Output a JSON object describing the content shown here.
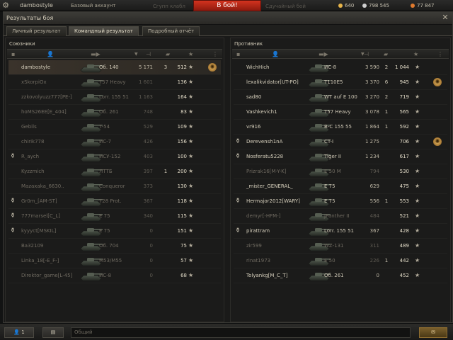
{
  "topbar": {
    "username": "dambostyle",
    "account": "Базовый аккаунт",
    "ghost_left": "Сгупп клабл",
    "ghost_right": "Сдучайный бой",
    "battle_button": "В бой!",
    "gold": "640",
    "credits": "798 545",
    "experience": "77 847",
    "colors": {
      "gold": "#e6b44a",
      "credits": "#cfcfcf",
      "experience": "#e07a2e"
    }
  },
  "window": {
    "title": "Результаты боя",
    "tabs": [
      "Личный результат",
      "Командный результат",
      "Подробный отчёт"
    ],
    "active_tab": 1
  },
  "allies": {
    "title": "Союзники",
    "players": [
      {
        "name": "dambostyle",
        "tank": "Об. 140",
        "damage": "5 171",
        "kills": "3",
        "xp": "512",
        "medal": false,
        "award": true,
        "dead": false,
        "me": true
      },
      {
        "name": "xSkorpiOx",
        "tank": "T57 Heavy",
        "damage": "1 601",
        "kills": "",
        "xp": "136",
        "medal": false,
        "award": false,
        "dead": true,
        "me": false
      },
      {
        "name": "zzkovolyuzz777[PE-]",
        "tank": "Lorr. 155 51",
        "damage": "1 163",
        "kills": "",
        "xp": "164",
        "medal": false,
        "award": false,
        "dead": true,
        "me": false
      },
      {
        "name": "hoMS26EE[E_404]",
        "tank": "Об. 261",
        "damage": "748",
        "kills": "",
        "xp": "83",
        "medal": false,
        "award": false,
        "dead": true,
        "me": false
      },
      {
        "name": "Gebils",
        "tank": "T-54",
        "damage": "529",
        "kills": "",
        "xp": "109",
        "medal": false,
        "award": false,
        "dead": true,
        "me": false
      },
      {
        "name": "chirik778",
        "tank": "ИС-7",
        "damage": "426",
        "kills": "",
        "xp": "156",
        "medal": false,
        "award": false,
        "dead": true,
        "me": false
      },
      {
        "name": "R_aych",
        "tank": "ИСУ-152",
        "damage": "403",
        "kills": "",
        "xp": "100",
        "medal": true,
        "award": false,
        "dead": true,
        "me": false
      },
      {
        "name": "Kyzzmich",
        "tank": "ЛТТБ",
        "damage": "397",
        "kills": "1",
        "xp": "200",
        "medal": false,
        "award": false,
        "dead": true,
        "me": false
      },
      {
        "name": "Mazaxaka_6630..",
        "tank": "Conqueror",
        "damage": "373",
        "kills": "",
        "xp": "130",
        "medal": false,
        "award": false,
        "dead": true,
        "me": false
      },
      {
        "name": "Gr0m_[AM-ST]",
        "tank": "T28 Prot.",
        "damage": "367",
        "kills": "",
        "xp": "118",
        "medal": true,
        "award": false,
        "dead": true,
        "me": false
      },
      {
        "name": "777marsel[C_L]",
        "tank": "E 75",
        "damage": "340",
        "kills": "",
        "xp": "115",
        "medal": true,
        "award": false,
        "dead": true,
        "me": false
      },
      {
        "name": "kyyyct[MSKIL]",
        "tank": "E 75",
        "damage": "0",
        "kills": "",
        "xp": "151",
        "medal": true,
        "award": false,
        "dead": true,
        "me": false
      },
      {
        "name": "Ba32109",
        "tank": "Об. 704",
        "damage": "0",
        "kills": "",
        "xp": "75",
        "medal": false,
        "award": false,
        "dead": true,
        "me": false
      },
      {
        "name": "Linka_18[-E_F-]",
        "tank": "M53/M55",
        "damage": "0",
        "kills": "",
        "xp": "57",
        "medal": false,
        "award": false,
        "dead": true,
        "me": false
      },
      {
        "name": "Direktor_game[L-45]",
        "tank": "ИС-8",
        "damage": "0",
        "kills": "",
        "xp": "68",
        "medal": false,
        "award": false,
        "dead": true,
        "me": false
      }
    ]
  },
  "enemies": {
    "title": "Противник",
    "players": [
      {
        "name": "WichHich",
        "tank": "ИС-8",
        "damage": "3 590",
        "kills": "2",
        "xp": "1 044",
        "medal": false,
        "award": false,
        "dead": false
      },
      {
        "name": "lexalikvidator[UT-PO]",
        "tank": "T110E5",
        "damage": "3 370",
        "kills": "6",
        "xp": "945",
        "medal": false,
        "award": true,
        "dead": false
      },
      {
        "name": "sad80",
        "tank": "WT auf E 100",
        "damage": "3 270",
        "kills": "2",
        "xp": "719",
        "medal": false,
        "award": false,
        "dead": false
      },
      {
        "name": "Vashkevich1",
        "tank": "T57 Heavy",
        "damage": "3 078",
        "kills": "1",
        "xp": "565",
        "medal": false,
        "award": false,
        "dead": false
      },
      {
        "name": "vr916",
        "tank": "B-C 155 55",
        "damage": "1 864",
        "kills": "1",
        "xp": "592",
        "medal": false,
        "award": false,
        "dead": false
      },
      {
        "name": "Derevensh1nA",
        "tank": "CT-I",
        "damage": "1 275",
        "kills": "",
        "xp": "706",
        "medal": true,
        "award": true,
        "dead": false
      },
      {
        "name": "Nosferatu5228",
        "tank": "Tiger II",
        "damage": "1 234",
        "kills": "",
        "xp": "617",
        "medal": true,
        "award": false,
        "dead": false
      },
      {
        "name": "Prizrak16[M-Y-K]",
        "tank": "E 50 M",
        "damage": "794",
        "kills": "",
        "xp": "530",
        "medal": false,
        "award": false,
        "dead": true
      },
      {
        "name": "_mister_GENERAL_",
        "tank": "E 75",
        "damage": "629",
        "kills": "",
        "xp": "475",
        "medal": false,
        "award": false,
        "dead": false
      },
      {
        "name": "Hermajor2012[WARY]",
        "tank": "E 75",
        "damage": "556",
        "kills": "1",
        "xp": "553",
        "medal": true,
        "award": false,
        "dead": false
      },
      {
        "name": "demyr[-HFM-]",
        "tank": "JPanther II",
        "damage": "484",
        "kills": "",
        "xp": "521",
        "medal": false,
        "award": false,
        "dead": true
      },
      {
        "name": "pirattram",
        "tank": "Lorr. 155 51",
        "damage": "367",
        "kills": "",
        "xp": "428",
        "medal": true,
        "award": false,
        "dead": false
      },
      {
        "name": "zir599",
        "tank": "WZ-131",
        "damage": "311",
        "kills": "",
        "xp": "489",
        "medal": false,
        "award": false,
        "dead": true
      },
      {
        "name": "rinat1973",
        "tank": "E 50",
        "damage": "226",
        "kills": "1",
        "xp": "442",
        "medal": false,
        "award": false,
        "dead": true
      },
      {
        "name": "Tolyankg[M_C_T]",
        "tank": "Об. 261",
        "damage": "0",
        "kills": "",
        "xp": "452",
        "medal": false,
        "award": false,
        "dead": false
      }
    ]
  },
  "bottombar": {
    "players_count": "1",
    "chat_placeholder": "Общий"
  }
}
